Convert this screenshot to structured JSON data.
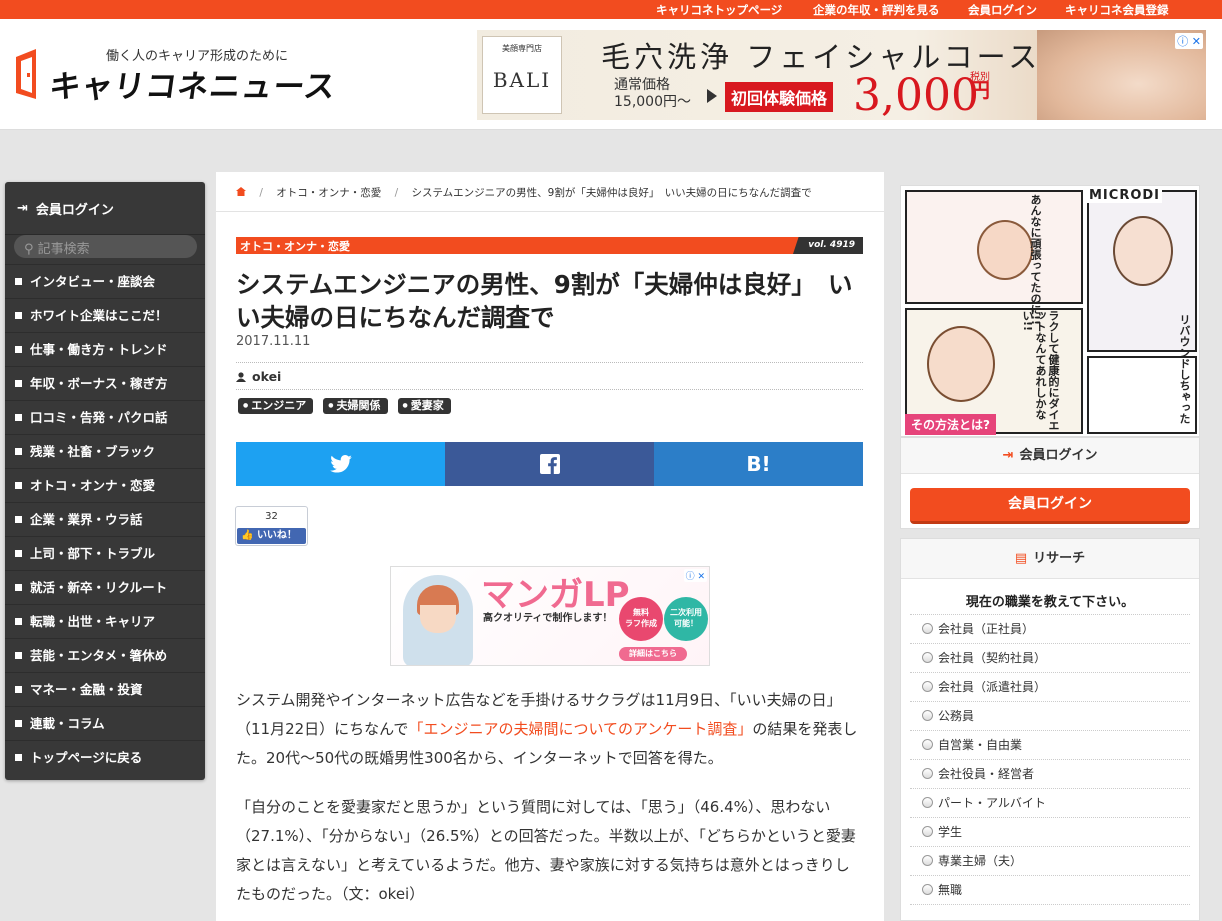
{
  "topnav": {
    "items": [
      "キャリコネトップページ",
      "企業の年収・評判を見る",
      "会員ログイン",
      "キャリコネ会員登録"
    ]
  },
  "header": {
    "tagline": "働く人のキャリア形成のために",
    "logo": "キャリコネニュース"
  },
  "header_ad": {
    "salon_small": "美顔専門店",
    "salon_name": "BALI",
    "title": "毛穴洗浄 フェイシャルコース",
    "regular_label": "通常価格",
    "regular_price": "15,000円～",
    "badge": "初回体験価格",
    "price": "3,000",
    "tax": "税別",
    "yen": "円",
    "adchoice": "ⓘ ✕"
  },
  "left_nav": {
    "login": "会員ログイン",
    "search_placeholder": "記事検索",
    "items": [
      "インタビュー・座談会",
      "ホワイト企業はここだ！",
      "仕事・働き方・トレンド",
      "年収・ボーナス・稼ぎ方",
      "口コミ・告発・パクロ話",
      "残業・社畜・ブラック",
      "オトコ・オンナ・恋愛",
      "企業・業界・ウラ話",
      "上司・部下・トラブル",
      "就活・新卒・リクルート",
      "転職・出世・キャリア",
      "芸能・エンタメ・箸休め",
      "マネー・金融・投資",
      "連載・コラム",
      "トップページに戻る"
    ]
  },
  "breadcrumb": {
    "category": "オトコ・オンナ・恋愛",
    "current": "システムエンジニアの男性、9割が「夫婦仲は良好」　いい夫婦の日にちなんだ調査で"
  },
  "article": {
    "category": "オトコ・オンナ・恋愛",
    "vol": "vol. 4919",
    "title": "システムエンジニアの男性、9割が「夫婦仲は良好」　いい夫婦の日にちなんだ調査で",
    "date": "2017.11.11",
    "author": "okei",
    "tags": [
      "エンジニア",
      "夫婦関係",
      "愛妻家"
    ],
    "share": {
      "twitter": "twitter",
      "facebook": "f",
      "hatena": "B!"
    },
    "like_count": "32",
    "like_label": "いいね！",
    "p1_a": "システム開発やインターネット広告などを手掛けるサクラグは11月9日、「いい夫婦の日」（11月22日）にちなんで",
    "p1_link": "「エンジニアの夫婦間についてのアンケート調査」",
    "p1_b": "の結果を発表した。20代～50代の既婚男性300名から、インターネットで回答を得た。",
    "p2": "「自分のことを愛妻家だと思うか」という質問に対しては、「思う」（46.4%）、思わない（27.1%）、「分からない」（26.5%）との回答だった。半数以上が、「どちらかというと愛妻家とは言えない」と考えているようだ。他方、妻や家族に対する気持ちは意外とはっきりしたものだった。（文：okei）"
  },
  "mid_ad": {
    "title": "マンガLP",
    "sub": "高クオリティで制作します！",
    "circle1": "無料\nラフ作成",
    "circle2": "二次利用\n可能！",
    "detail": "詳細はこちら"
  },
  "right_ad": {
    "brand": "MICRODI",
    "t1": "あんなに頑張ってたのに!!",
    "t2": "リバウンドしちゃった",
    "t3": "ラクして健康的にダイエットなんてあれしかない!!",
    "cta": "その方法とは?"
  },
  "right_login": {
    "head": "会員ログイン",
    "button": "会員ログイン"
  },
  "research": {
    "head": "リサーチ",
    "question": "現在の職業を教えて下さい。",
    "options": [
      "会社員（正社員）",
      "会社員（契約社員）",
      "会社員（派遣社員）",
      "公務員",
      "自営業・自由業",
      "会社役員・経営者",
      "パート・アルバイト",
      "学生",
      "専業主婦（夫）",
      "無職"
    ]
  },
  "colors": {
    "accent": "#f24c1f",
    "nav_bg": "#383838",
    "twitter": "#1da1f2",
    "facebook": "#3b5998",
    "hatena": "#2c7ec8"
  }
}
